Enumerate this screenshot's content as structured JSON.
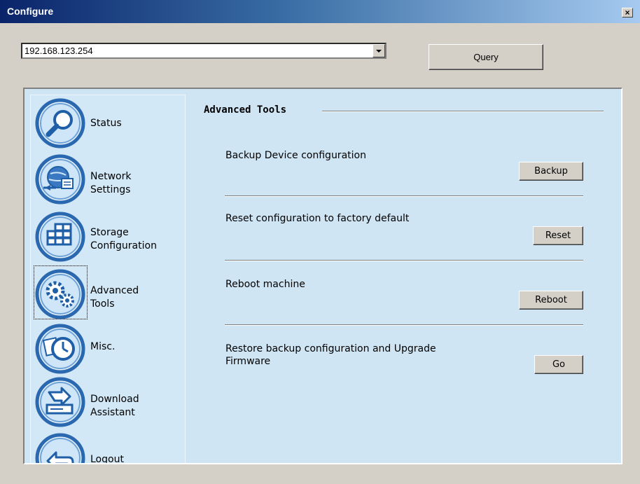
{
  "window": {
    "title": "Configure",
    "close_glyph": "×"
  },
  "address": {
    "value": "192.168.123.254"
  },
  "query_button": "Query",
  "sidebar": {
    "items": [
      {
        "line1": "Status",
        "line2": "",
        "icon": "magnifier-icon"
      },
      {
        "line1": "Network",
        "line2": "Settings",
        "icon": "network-globe-icon"
      },
      {
        "line1": "Storage",
        "line2": "Configuration",
        "icon": "storage-grid-icon"
      },
      {
        "line1": "Advanced",
        "line2": "Tools",
        "icon": "gears-icon",
        "selected": true
      },
      {
        "line1": "Misc.",
        "line2": "",
        "icon": "clock-icon"
      },
      {
        "line1": "Download",
        "line2": "Assistant",
        "icon": "download-tray-icon"
      },
      {
        "line1": "Logout",
        "line2": "",
        "icon": "back-arrow-icon"
      }
    ]
  },
  "section": {
    "title": "Advanced Tools"
  },
  "tools": [
    {
      "label": "Backup Device configuration",
      "button": "Backup"
    },
    {
      "label": "Reset configuration to factory default",
      "button": "Reset"
    },
    {
      "label": "Reboot machine",
      "button": "Reboot"
    },
    {
      "label_line1": "Restore backup configuration and Upgrade",
      "label_line2": "Firmware",
      "button": "Go"
    }
  ],
  "colors": {
    "panel_bg": "#cfe5f4",
    "icon_blue": "#1f5fa8",
    "titlebar": "#0a246a"
  }
}
